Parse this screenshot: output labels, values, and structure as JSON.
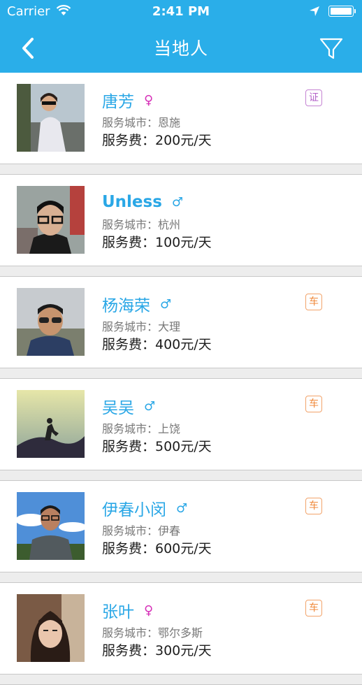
{
  "status_bar": {
    "carrier": "Carrier",
    "time": "2:41 PM"
  },
  "nav": {
    "title": "当地人"
  },
  "colors": {
    "accent": "#2aaee9",
    "female": "#d630b8",
    "male": "#2aa7e6",
    "badge_cert": "#b35fc8",
    "badge_car": "#f08a3c"
  },
  "icons": {
    "back": "chevron-left-icon",
    "filter": "funnel-icon",
    "female": "♀",
    "male": "♂"
  },
  "people": [
    {
      "name": "唐芳",
      "gender": "♀",
      "gender_class": "g-f",
      "city": "服务城市：恩施",
      "fee": "服务费：200元/天",
      "badge": "证",
      "badge_type": "zheng"
    },
    {
      "name": "Unless",
      "gender": "♂",
      "gender_class": "g-m",
      "city": "服务城市：杭州",
      "fee": "服务费：100元/天",
      "badge": "",
      "badge_type": ""
    },
    {
      "name": "杨海荣",
      "gender": "♂",
      "gender_class": "g-m",
      "city": "服务城市：大理",
      "fee": "服务费：400元/天",
      "badge": "车",
      "badge_type": "che"
    },
    {
      "name": "吴吴",
      "gender": "♂",
      "gender_class": "g-m",
      "city": "服务城市：上饶",
      "fee": "服务费：500元/天",
      "badge": "车",
      "badge_type": "che"
    },
    {
      "name": "伊春小闵",
      "gender": "♂",
      "gender_class": "g-m",
      "city": "服务城市：伊春",
      "fee": "服务费：600元/天",
      "badge": "车",
      "badge_type": "che"
    },
    {
      "name": "张叶",
      "gender": "♀",
      "gender_class": "g-f",
      "city": "服务城市：鄂尔多斯",
      "fee": "服务费：300元/天",
      "badge": "车",
      "badge_type": "che"
    }
  ]
}
